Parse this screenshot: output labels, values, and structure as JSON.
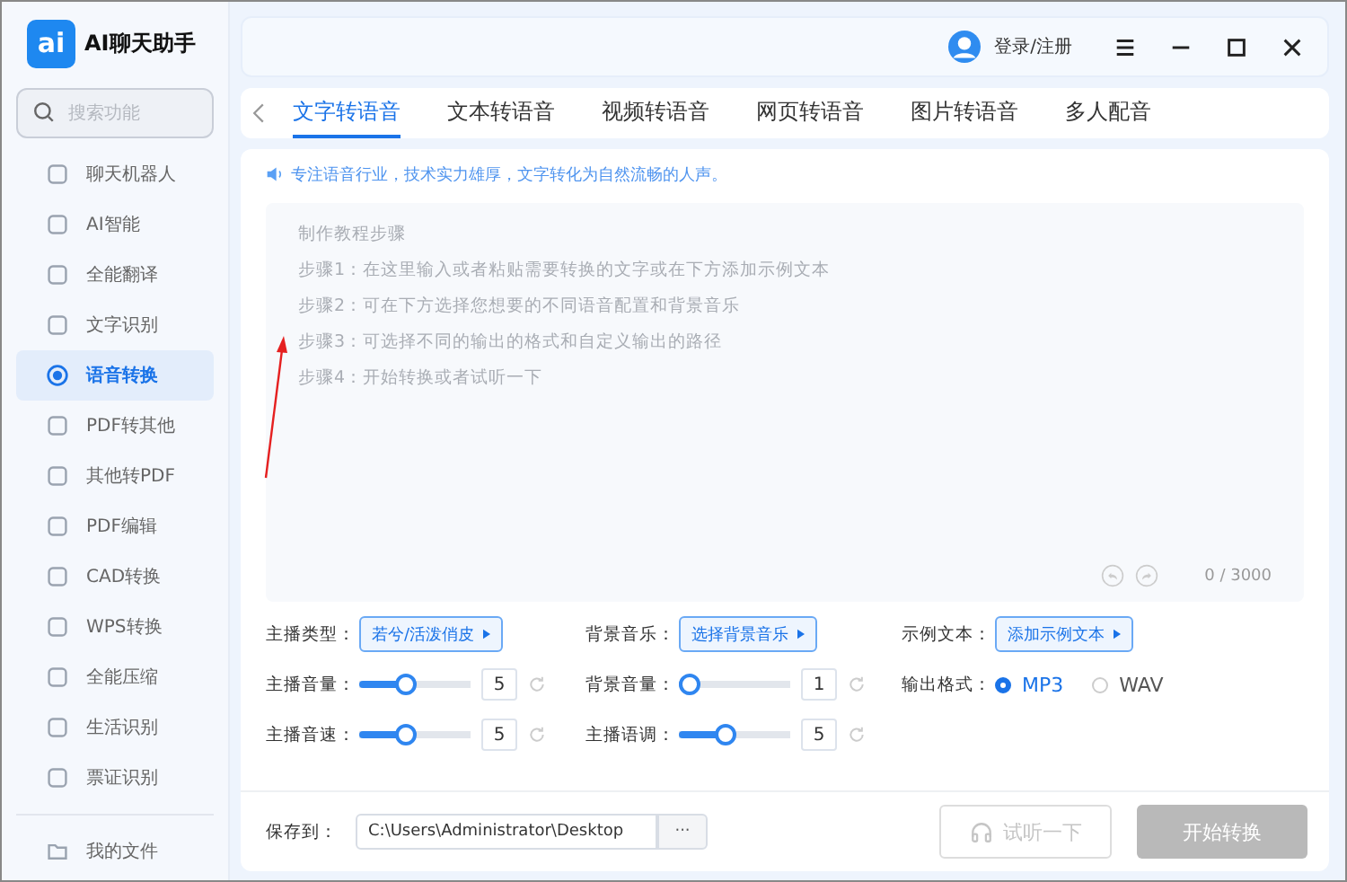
{
  "app": {
    "logo": "ai",
    "title": "AI聊天助手"
  },
  "search": {
    "placeholder": "搜索功能"
  },
  "sidebar": {
    "items": [
      {
        "label": "聊天机器人",
        "selected": false
      },
      {
        "label": "AI智能",
        "selected": false
      },
      {
        "label": "全能翻译",
        "selected": false
      },
      {
        "label": "文字识别",
        "selected": false
      },
      {
        "label": "语音转换",
        "selected": true
      },
      {
        "label": "PDF转其他",
        "selected": false
      },
      {
        "label": "其他转PDF",
        "selected": false
      },
      {
        "label": "PDF编辑",
        "selected": false
      },
      {
        "label": "CAD转换",
        "selected": false
      },
      {
        "label": "WPS转换",
        "selected": false
      },
      {
        "label": "全能压缩",
        "selected": false
      },
      {
        "label": "生活识别",
        "selected": false
      },
      {
        "label": "票证识别",
        "selected": false
      }
    ],
    "footer_item": {
      "label": "我的文件"
    }
  },
  "header": {
    "login": "登录/注册"
  },
  "tabs": [
    {
      "label": "文字转语音",
      "selected": true
    },
    {
      "label": "文本转语音",
      "selected": false
    },
    {
      "label": "视频转语音",
      "selected": false
    },
    {
      "label": "网页转语音",
      "selected": false
    },
    {
      "label": "图片转语音",
      "selected": false
    },
    {
      "label": "多人配音",
      "selected": false
    }
  ],
  "tagline": "专注语音行业，技术实力雄厚，文字转化为自然流畅的人声。",
  "editor": {
    "placeholder": [
      "制作教程步骤",
      "步骤1：在这里输入或者粘贴需要转换的文字或在下方添加示例文本",
      "步骤2：可在下方选择您想要的不同语音配置和背景音乐",
      "步骤3：可选择不同的输出的格式和自定义输出的路径",
      "步骤4：开始转换或者试听一下"
    ],
    "counter": "0 / 3000"
  },
  "settings": [
    {
      "kind": "select",
      "label": "主播类型：",
      "value": "若兮/活泼俏皮"
    },
    {
      "kind": "select",
      "label": "背景音乐：",
      "value": "选择背景音乐"
    },
    {
      "kind": "select",
      "label": "示例文本：",
      "value": "添加示例文本"
    },
    {
      "kind": "slider",
      "label": "主播音量：",
      "level": 0.4,
      "value": "5"
    },
    {
      "kind": "slider",
      "label": "背景音量：",
      "level": 0.0,
      "value": "1"
    },
    {
      "kind": "radio",
      "label": "输出格式：",
      "options": [
        {
          "label": "MP3",
          "selected": true
        },
        {
          "label": "WAV",
          "selected": false
        }
      ]
    },
    {
      "kind": "slider",
      "label": "主播音速：",
      "level": 0.4,
      "value": "5"
    },
    {
      "kind": "slider",
      "label": "主播语调：",
      "level": 0.4,
      "value": "5"
    }
  ],
  "footer": {
    "save_label": "保存到：",
    "path": "C:\\Users\\Administrator\\Desktop",
    "browse": "···",
    "listen": {
      "label": "试听一下",
      "disabled": true
    },
    "start": {
      "label": "开始转换",
      "disabled": true
    }
  }
}
